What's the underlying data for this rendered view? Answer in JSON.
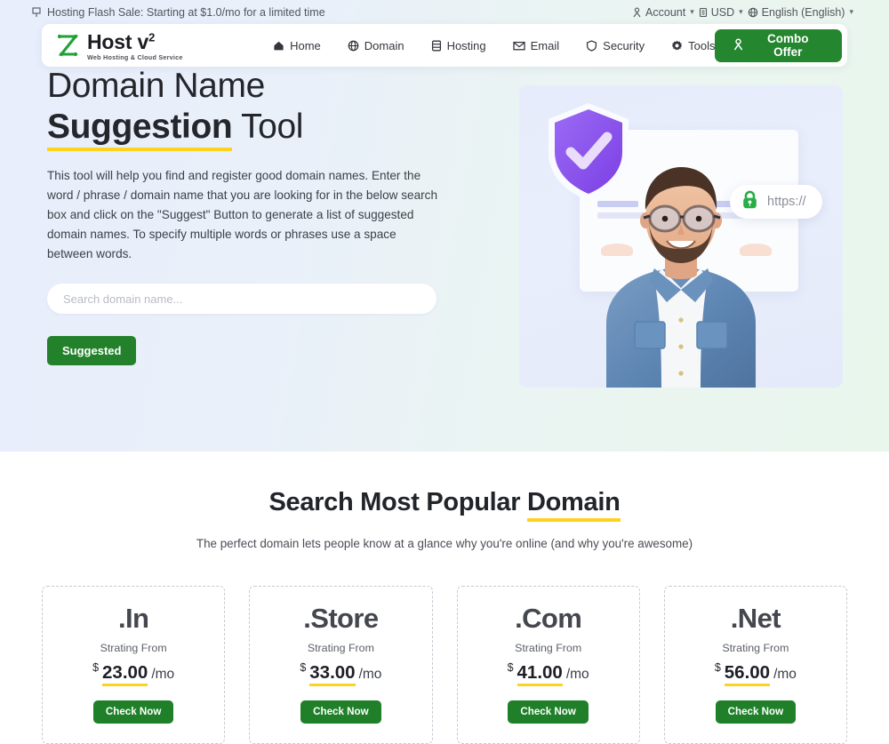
{
  "topbar": {
    "promo_icon": "flag-icon",
    "promo_text": "Hosting Flash Sale: Starting at $1.0/mo for a limited time",
    "account_icon": "user-icon",
    "account_label": "Account",
    "currency_icon": "money-icon",
    "currency_label": "USD",
    "language_icon": "globe-icon",
    "language_label": "English (English)",
    "caret": "⌄"
  },
  "navbar": {
    "logo": {
      "mark_icon": "z-logo-icon",
      "title": "Host v",
      "title_sup": "2",
      "tagline": "Web Hosting & Cloud  Service"
    },
    "links": [
      {
        "label": "Home",
        "icon": "home-icon"
      },
      {
        "label": "Domain",
        "icon": "globe-icon"
      },
      {
        "label": "Hosting",
        "icon": "server-icon"
      },
      {
        "label": "Email",
        "icon": "envelope-icon"
      },
      {
        "label": "Security",
        "icon": "shield-icon"
      },
      {
        "label": "Tools",
        "icon": "gear-icon"
      }
    ],
    "combo_button": {
      "label": "Combo Offer",
      "icon": "user-icon",
      "color": "#24862e"
    }
  },
  "hero": {
    "title_line1": "Domain Name",
    "title_strong": "Suggestion",
    "title_tail": " Tool",
    "paragraph": "This tool will help you find and register good domain names. Enter the word / phrase / domain name that you are looking for in the below search box and click on the \"Suggest\" Button to generate a list of suggested domain names. To specify multiple words or phrases use a space between words.",
    "search_placeholder": "Search domain name...",
    "search_value": "",
    "suggest_button": "Suggested",
    "underline_color": "#ffd21f",
    "art": {
      "shield_icon": "shield-check-icon",
      "lock_icon": "lock-icon",
      "https_text": "https://",
      "person_alt": "smiling-man-in-denim-shirt"
    }
  },
  "popular": {
    "heading_normal": "Search Most Popular ",
    "heading_underlined": "Domain",
    "subtitle": "The perfect domain lets people know at a glance why you're online (and why you're awesome)",
    "cards": [
      {
        "tld": ".In",
        "from_label": "Strating From",
        "currency": "$",
        "price": "23.00",
        "period": "/mo",
        "cta": "Check Now"
      },
      {
        "tld": ".Store",
        "from_label": "Strating From",
        "currency": "$",
        "price": "33.00",
        "period": "/mo",
        "cta": "Check Now"
      },
      {
        "tld": ".Com",
        "from_label": "Strating From",
        "currency": "$",
        "price": "41.00",
        "period": "/mo",
        "cta": "Check Now"
      },
      {
        "tld": ".Net",
        "from_label": "Strating From",
        "currency": "$",
        "price": "56.00",
        "period": "/mo",
        "cta": "Check Now"
      }
    ]
  }
}
